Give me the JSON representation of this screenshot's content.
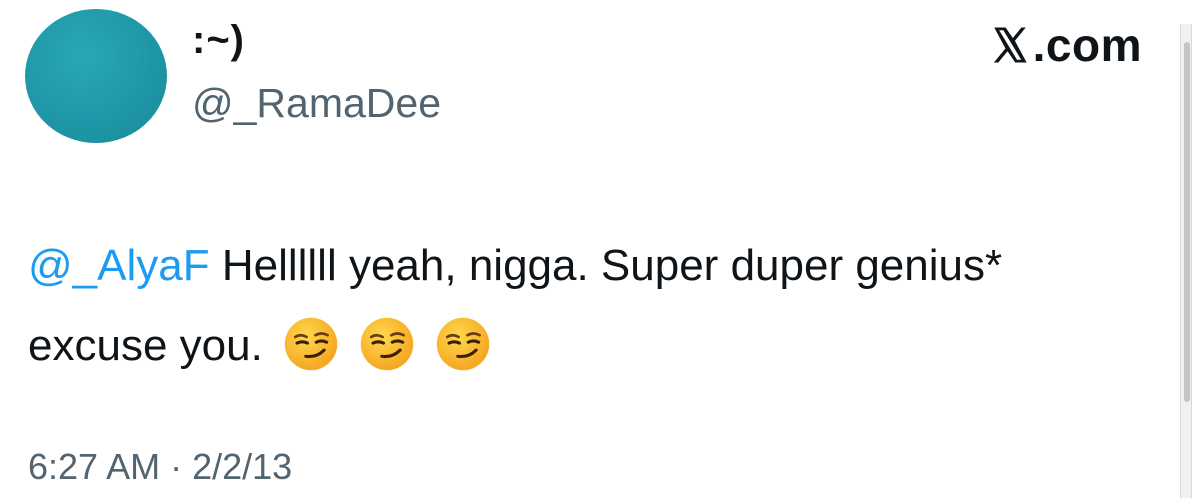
{
  "author": {
    "display_name": ":~)",
    "handle": "@_RamaDee",
    "avatar_color": "#1f97a8"
  },
  "brand": {
    "text": ".com",
    "logo_icon": "x-logo-icon"
  },
  "tweet": {
    "mention": "@_AlyaF",
    "line1_rest": " Hellllll yeah, nigga. Super duper genius*",
    "line2": "excuse you.",
    "emojis": [
      "smirking-face-emoji",
      "smirking-face-emoji",
      "smirking-face-emoji"
    ]
  },
  "timestamp": "6:27 AM · 2/2/13",
  "colors": {
    "mention": "#1d9bf0",
    "secondary_text": "#536471",
    "primary_text": "#0f1419"
  }
}
